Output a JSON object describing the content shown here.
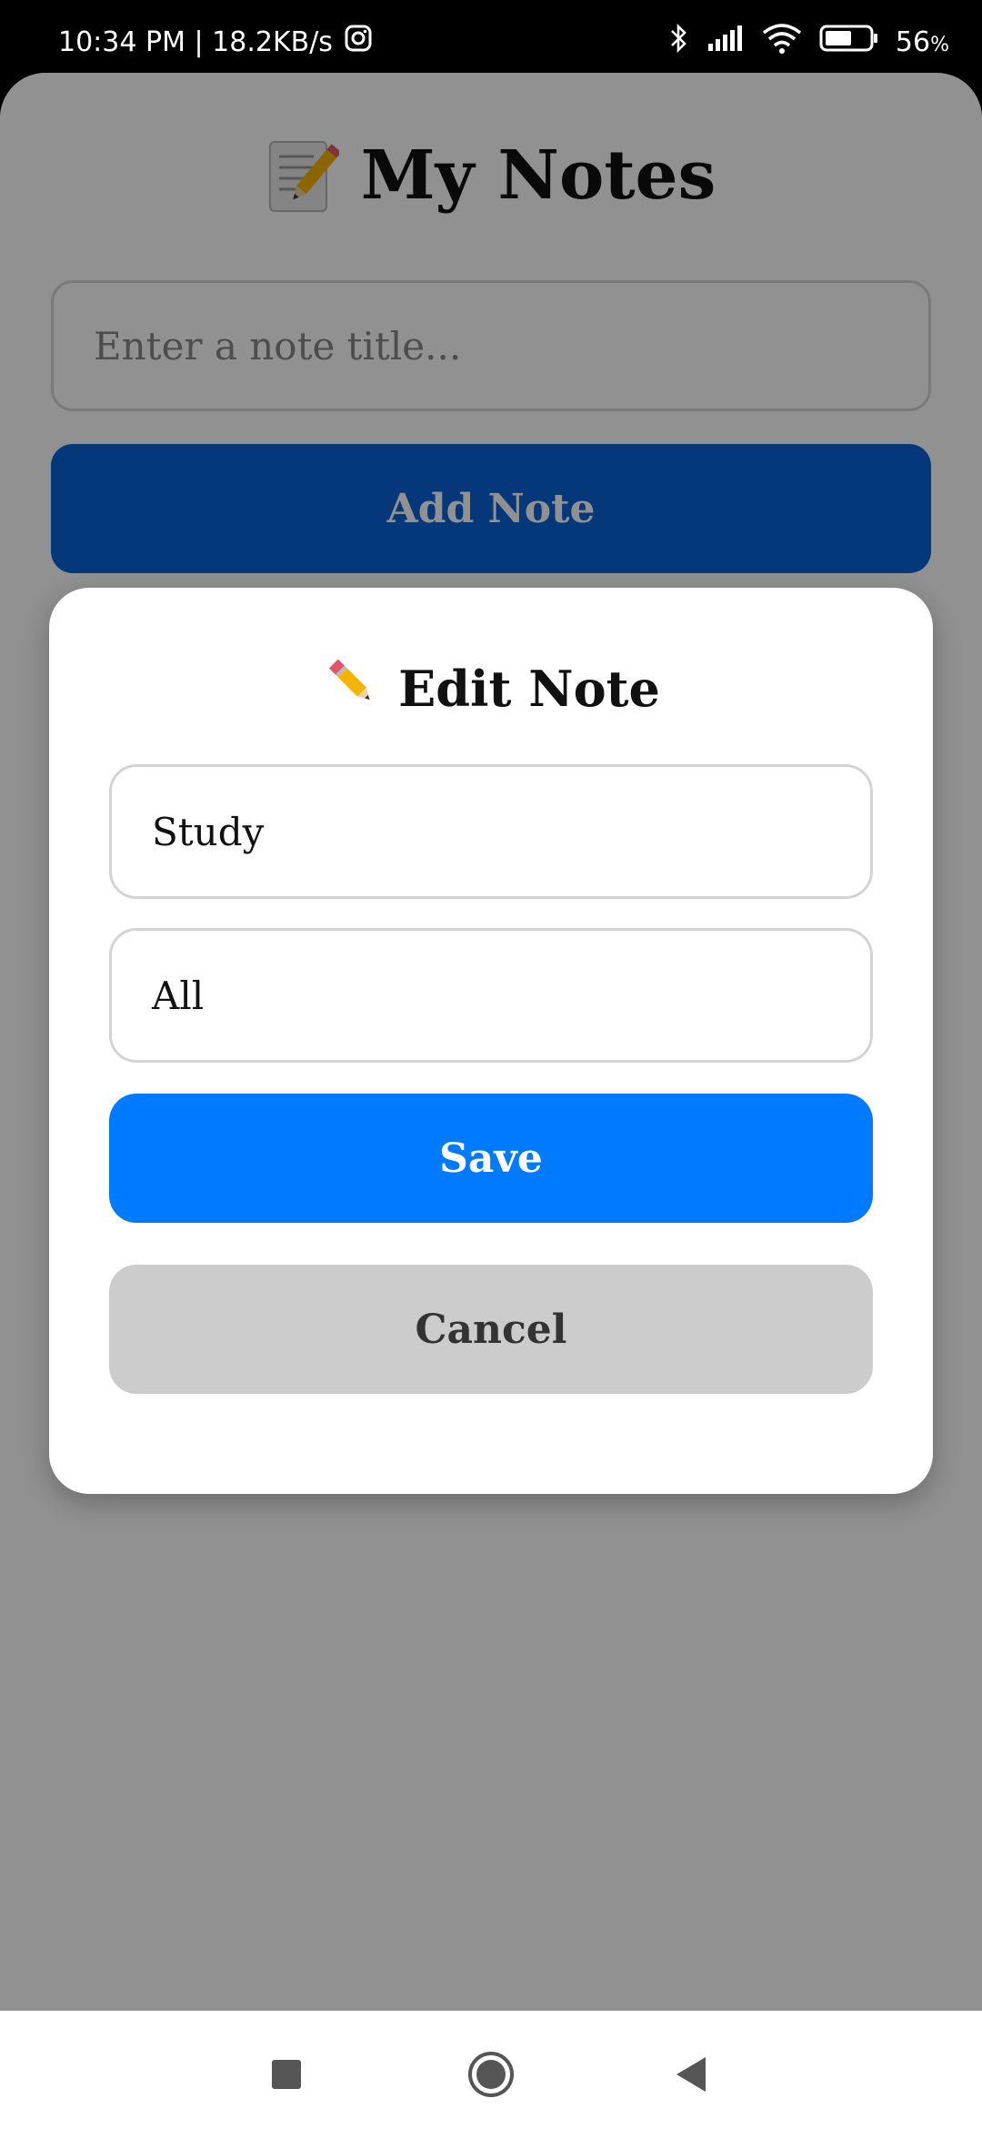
{
  "status_bar": {
    "time_speed": "10:34 PM | 18.2KB/s",
    "battery_percent": "56",
    "battery_unit": "%",
    "icons": [
      "instagram-icon",
      "bluetooth-icon",
      "signal-icon",
      "wifi-icon",
      "battery-icon"
    ]
  },
  "app": {
    "title": "My Notes",
    "title_icon": "memo-icon",
    "note_input": {
      "value": "",
      "placeholder": "Enter a note title..."
    },
    "add_button_label": "Add Note"
  },
  "modal": {
    "title": "Edit Note",
    "title_icon": "pencil-icon",
    "title_field_value": "Study",
    "category_field_value": "All",
    "save_label": "Save",
    "cancel_label": "Cancel"
  },
  "nav": {
    "icons": [
      "recent-apps-icon",
      "home-icon",
      "back-icon"
    ]
  },
  "colors": {
    "primary": "#007bff",
    "cancel": "#cccccc",
    "overlay": "#000000"
  }
}
